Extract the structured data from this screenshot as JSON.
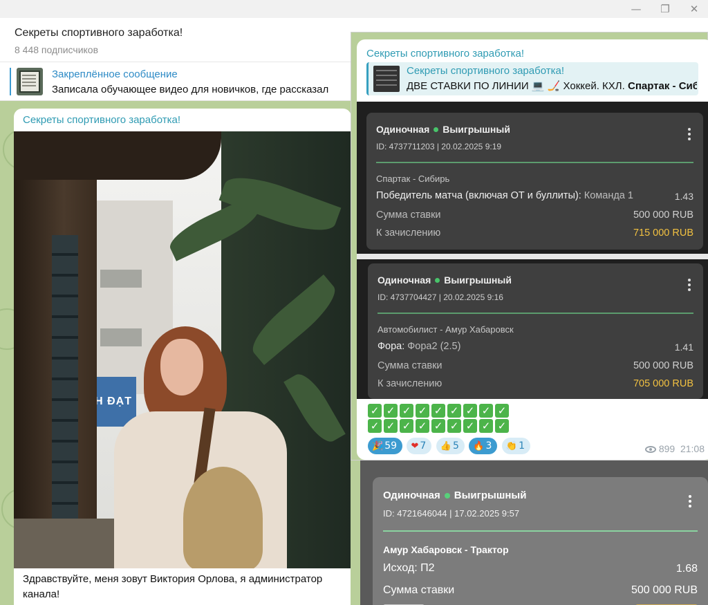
{
  "window": {
    "minimize": "—",
    "restore": "❐",
    "close": "✕"
  },
  "channel": {
    "title": "Секреты спортивного заработка!",
    "subscribers": "8 448 подписчиков"
  },
  "pinned": {
    "title": "Закреплённое сообщение",
    "text": "Записала обучающее видео для новичков, где рассказал"
  },
  "post1": {
    "channel": "Секреты спортивного заработка!",
    "photo_sign": "ÀNH ĐẠT",
    "caption": "Здравствуйте, меня зовут Виктория Орлова, я администратор канала!"
  },
  "post2": {
    "channel": "Секреты спортивного заработка!",
    "reply": {
      "title": "Секреты спортивного заработка!",
      "text": "ДВЕ СТАВКИ ПО ЛИНИИ 💻 🏒 Хоккей. КХЛ. ",
      "text_bold": "Спартак - Сибирь"
    },
    "bets": [
      {
        "type": "Одиночная",
        "status": "Выигрышный",
        "id": "ID: 4737711203  |  20.02.2025 9:19",
        "match": "Спартак - Сибирь",
        "market": "Победитель матча (включая ОТ и буллиты):",
        "selection": "Команда 1",
        "odd": "1.43",
        "stake_label": "Сумма ставки",
        "stake": "500 000 RUB",
        "payout_label": "К зачислению",
        "payout": "715 000 RUB"
      },
      {
        "type": "Одиночная",
        "status": "Выигрышный",
        "id": "ID: 4737704427  |  20.02.2025 9:16",
        "match": "Автомобилист - Амур Хабаровск",
        "market": "Фора:",
        "selection": "Фора2 (2.5)",
        "odd": "1.41",
        "stake_label": "Сумма ставки",
        "stake": "500 000 RUB",
        "payout_label": "К зачислению",
        "payout": "705 000 RUB"
      }
    ],
    "check_mark": "✓",
    "reactions": [
      {
        "emoji": "🎉",
        "count": "59",
        "selected": true
      },
      {
        "emoji": "❤",
        "count": "7",
        "selected": false
      },
      {
        "emoji": "👍",
        "count": "5",
        "selected": false
      },
      {
        "emoji": "🔥",
        "count": "3",
        "selected": true
      },
      {
        "emoji": "👏",
        "count": "1",
        "selected": false
      }
    ],
    "views": "899",
    "time": "21:08"
  },
  "post3": {
    "bet": {
      "type": "Одиночная",
      "status": "Выигрышный",
      "id": "ID: 4721646044  |  17.02.2025 9:57",
      "match": "Амур Хабаровск - Трактор",
      "market": "Исход:  П2",
      "odd": "1.68",
      "stake_label": "Сумма ставки",
      "stake": "500 000 RUB"
    }
  },
  "colors": {
    "accent": "#2f9bb3",
    "link": "#2e8bc6",
    "win_dot": "#48c46a",
    "payout": "#f2c141",
    "chat_bg": "#b9cf9a"
  }
}
